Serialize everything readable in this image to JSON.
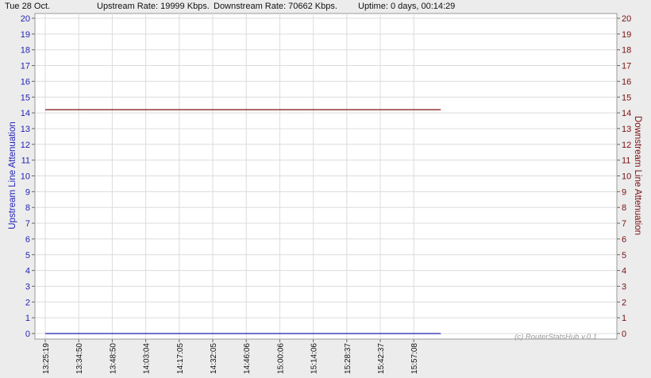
{
  "header": {
    "date": "Tue 28 Oct.",
    "upstream_rate": "Upstream Rate: 19999 Kbps.",
    "downstream_rate": "Downstream Rate: 70662 Kbps.",
    "uptime": "Uptime: 0 days, 00:14:29"
  },
  "watermark": "(c) RouterStatsHub v.0.1",
  "colors": {
    "upstream": "#1f1fb4",
    "downstream": "#7a1010",
    "grid": "#dcdcdc"
  },
  "chart_data": {
    "type": "line",
    "x": [
      "13:25:19",
      "13:34:50",
      "13:48:50",
      "14:03:04",
      "14:17:05",
      "14:32:05",
      "14:46:06",
      "15:00:06",
      "15:14:06",
      "15:28:37",
      "15:42:37",
      "15:57:08"
    ],
    "series": [
      {
        "axis": "left",
        "values": [
          0,
          0,
          0,
          0,
          0,
          0,
          0,
          0,
          0,
          0,
          0,
          0
        ]
      },
      {
        "axis": "right",
        "values": [
          14.2,
          14.2,
          14.2,
          14.2,
          14.2,
          14.2,
          14.2,
          14.2,
          14.2,
          14.2,
          14.2,
          14.2
        ]
      }
    ],
    "ylabel_left": "Upstream Line Attenuation",
    "ylabel_right": "Downstream Line Attenuation",
    "ylim": [
      0,
      20
    ],
    "yticks": [
      "0",
      "1",
      "2",
      "3",
      "4",
      "5",
      "6",
      "7",
      "8",
      "9",
      "10",
      "11",
      "12",
      "13",
      "14",
      "15",
      "16",
      "17",
      "18",
      "19",
      "20"
    ],
    "grid": true
  }
}
